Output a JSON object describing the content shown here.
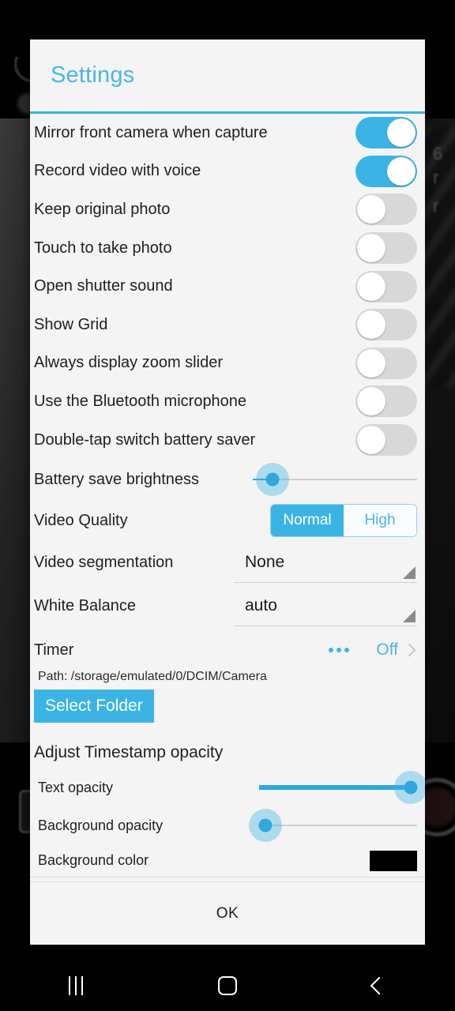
{
  "dialog": {
    "title": "Settings",
    "ok_label": "OK",
    "accent_color": "#3bb4e5",
    "toggles": [
      {
        "label": "Mirror front camera when capture",
        "state": "on"
      },
      {
        "label": "Record video with voice",
        "state": "on"
      },
      {
        "label": "Keep original photo",
        "state": "off"
      },
      {
        "label": "Touch to take photo",
        "state": "off"
      },
      {
        "label": "Open shutter sound",
        "state": "off"
      },
      {
        "label": "Show Grid",
        "state": "off"
      },
      {
        "label": "Always display zoom slider",
        "state": "off"
      },
      {
        "label": "Use the Bluetooth microphone",
        "state": "off"
      },
      {
        "label": "Double-tap switch battery saver",
        "state": "off"
      }
    ],
    "battery_brightness": {
      "label": "Battery save brightness",
      "value_percent": 12
    },
    "video_quality": {
      "label": "Video Quality",
      "options": [
        "Normal",
        "High"
      ],
      "selected": "Normal"
    },
    "video_segmentation": {
      "label": "Video segmentation",
      "value": "None"
    },
    "white_balance": {
      "label": "White Balance",
      "value": "auto"
    },
    "timer": {
      "label": "Timer",
      "value": "Off",
      "overflow_icon": "more-horizontal-icon"
    },
    "path": {
      "text": "Path: /storage/emulated/0/DCIM/Camera"
    },
    "select_folder": {
      "label": "Select Folder"
    },
    "timestamp": {
      "section_title": "Adjust Timestamp opacity",
      "text_opacity": {
        "label": "Text opacity",
        "value_percent": 96
      },
      "background_opacity": {
        "label": "Background opacity",
        "value_percent": 4
      },
      "background_color": {
        "label": "Background color",
        "swatch_hex": "#000000"
      }
    }
  },
  "navbar": {
    "recents_label": "recents-icon",
    "home_label": "home-icon",
    "back_label": "back-icon"
  }
}
